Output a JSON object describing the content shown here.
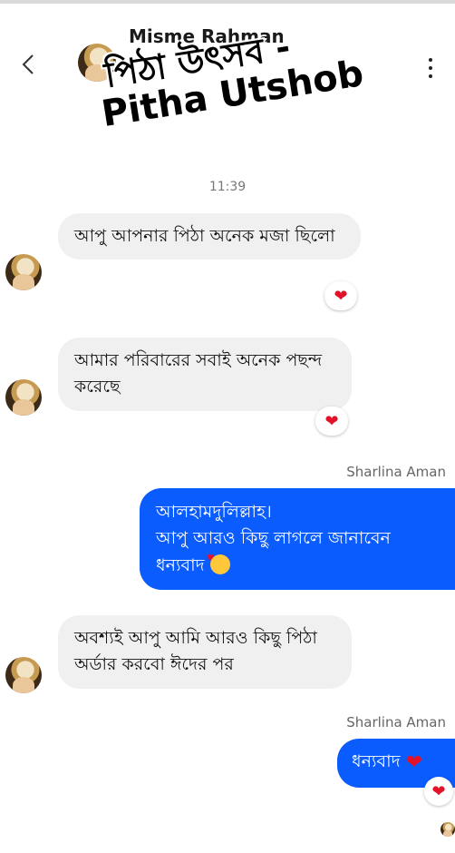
{
  "header": {
    "contact_name": "Misme Rahman",
    "subtitle": "",
    "back_icon": "chevron-left-icon",
    "menu_icon": "more-vertical-icon"
  },
  "overlay_title": {
    "line1": "পিঠা উৎসব -",
    "line2": "Pitha Utshob"
  },
  "conversation": {
    "time": "11:39",
    "messages": [
      {
        "direction": "in",
        "text": "আপু আপনার পিঠা অনেক মজা ছিলো",
        "reaction": "❤"
      },
      {
        "direction": "in",
        "text": "আমার পরিবারের সবাই অনেক পছন্দ করেছে",
        "reaction": "❤"
      },
      {
        "direction": "out",
        "sender": "Sharlina Aman",
        "line1": "আলহামদুলিল্লাহ।",
        "line2": "আপু আরও কিছু লাগলে জানাবেন",
        "line3": "ধন্যবাদ"
      },
      {
        "direction": "in",
        "text": "অবশ্যই আপু আমি আরও কিছু পিঠা অর্ডার করবো ঈদের পর"
      },
      {
        "direction": "out",
        "sender": "Sharlina Aman",
        "text": "ধন্যবাদ",
        "inline_emoji": "❤",
        "reaction": "❤"
      }
    ]
  },
  "colors": {
    "outgoing_bubble": "#0a5cff",
    "incoming_bubble": "#f0f0f0",
    "reaction_heart": "#e3122a"
  }
}
